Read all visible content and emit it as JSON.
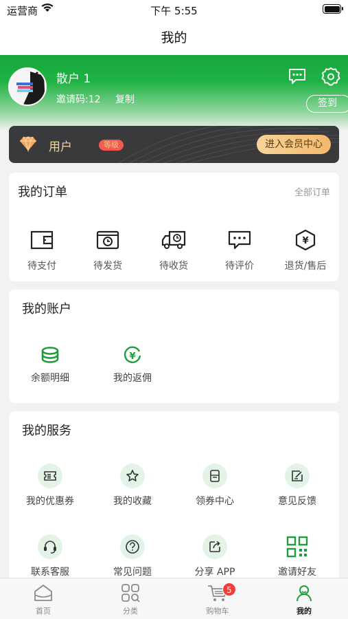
{
  "status_bar": {
    "carrier": "运营商",
    "time": "下午 5:55"
  },
  "nav": {
    "title": "我的"
  },
  "profile": {
    "name": "散户 1",
    "invite_code": "邀请码:12",
    "copy_label": "复制",
    "signin_label": "签到"
  },
  "member": {
    "user_label": "用户",
    "level_label": "等级",
    "center_button": "进入会员中心"
  },
  "orders": {
    "title": "我的订单",
    "all_label": "全部订单",
    "items": [
      {
        "label": "待支付",
        "icon": "wallet-icon"
      },
      {
        "label": "待发货",
        "icon": "clock-box-icon"
      },
      {
        "label": "待收货",
        "icon": "truck-icon"
      },
      {
        "label": "待评价",
        "icon": "comment-icon"
      },
      {
        "label": "退货/售后",
        "icon": "yuan-hexagon-icon"
      }
    ]
  },
  "account": {
    "title": "我的账户",
    "items": [
      {
        "label": "余额明细",
        "icon": "coins-stack-icon"
      },
      {
        "label": "我的返佣",
        "icon": "yuan-circle-icon"
      }
    ]
  },
  "services": {
    "title": "我的服务",
    "items": [
      {
        "label": "我的优惠券",
        "icon": "coupon-icon"
      },
      {
        "label": "我的收藏",
        "icon": "star-icon"
      },
      {
        "label": "领券中心",
        "icon": "coupon-center-icon"
      },
      {
        "label": "意见反馈",
        "icon": "feedback-icon"
      },
      {
        "label": "联系客服",
        "icon": "headset-icon"
      },
      {
        "label": "常见问题",
        "icon": "question-icon"
      },
      {
        "label": "分享 APP",
        "icon": "share-icon"
      },
      {
        "label": "邀请好友",
        "icon": "qrcode-icon"
      }
    ]
  },
  "tabbar": {
    "tabs": [
      {
        "label": "首页",
        "icon": "home-icon"
      },
      {
        "label": "分类",
        "icon": "category-icon"
      },
      {
        "label": "购物车",
        "icon": "cart-icon",
        "badge": "5"
      },
      {
        "label": "我的",
        "icon": "user-icon",
        "active": true
      }
    ]
  },
  "colors": {
    "brand_green": "#1fb243",
    "badge_red": "#f03c3c",
    "member_gold": "#f4b86b"
  }
}
